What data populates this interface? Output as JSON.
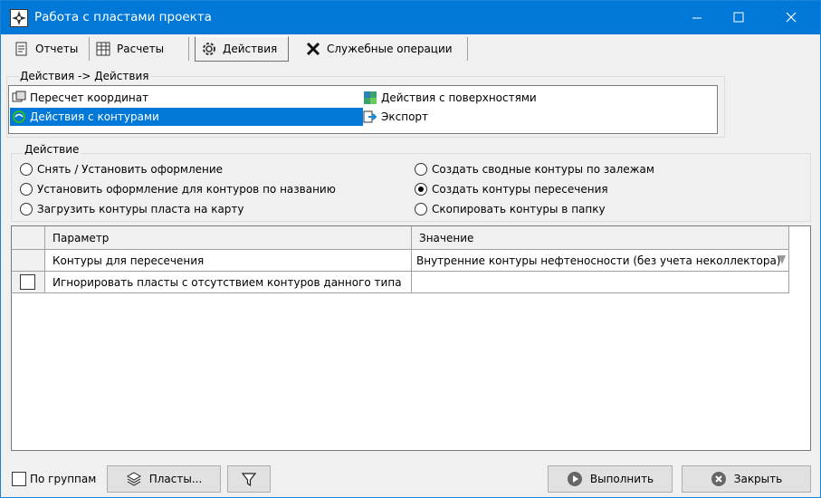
{
  "window": {
    "title": "Работа с пластами проекта"
  },
  "tabs": [
    {
      "label": "Отчеты"
    },
    {
      "label": "Расчеты"
    },
    {
      "label": "Действия"
    },
    {
      "label": "Служебные операции"
    }
  ],
  "actions_group": {
    "label": "Действия -> Действия",
    "items": [
      {
        "label": "Пересчет координат",
        "icon": "recalc-icon",
        "selected": false
      },
      {
        "label": "Действия с контурами",
        "icon": "contour-icon",
        "selected": true
      },
      {
        "label": "Действия с поверхностями",
        "icon": "surface-icon",
        "selected": false
      },
      {
        "label": "Экспорт",
        "icon": "export-icon",
        "selected": false
      }
    ]
  },
  "action_group": {
    "label": "Действие",
    "options": [
      {
        "label": "Снять / Установить оформление",
        "checked": false
      },
      {
        "label": "Установить оформление для контуров по названию",
        "checked": false
      },
      {
        "label": "Загрузить контуры пласта на карту",
        "checked": false
      },
      {
        "label": "Создать сводные контуры по залежам",
        "checked": false
      },
      {
        "label": "Создать контуры пересечения",
        "checked": true
      },
      {
        "label": "Скопировать контуры в папку",
        "checked": false
      }
    ]
  },
  "grid": {
    "columns": [
      "Параметр",
      "Значение"
    ],
    "rows": [
      {
        "param": "Контуры для пересечения",
        "value": "Внутренние контуры нефтеносности (без учета неколлектора)",
        "has_checkbox": false
      },
      {
        "param": "Игнорировать пласты с отсутствием контуров данного типа",
        "value": "",
        "has_checkbox": true
      }
    ]
  },
  "bottom": {
    "by_groups_label": "По группам",
    "layers_button": "Пласты...",
    "run_button": "Выполнить",
    "close_button": "Закрыть"
  },
  "colors": {
    "titlebar": "#0078d7",
    "selection": "#0078d7"
  }
}
